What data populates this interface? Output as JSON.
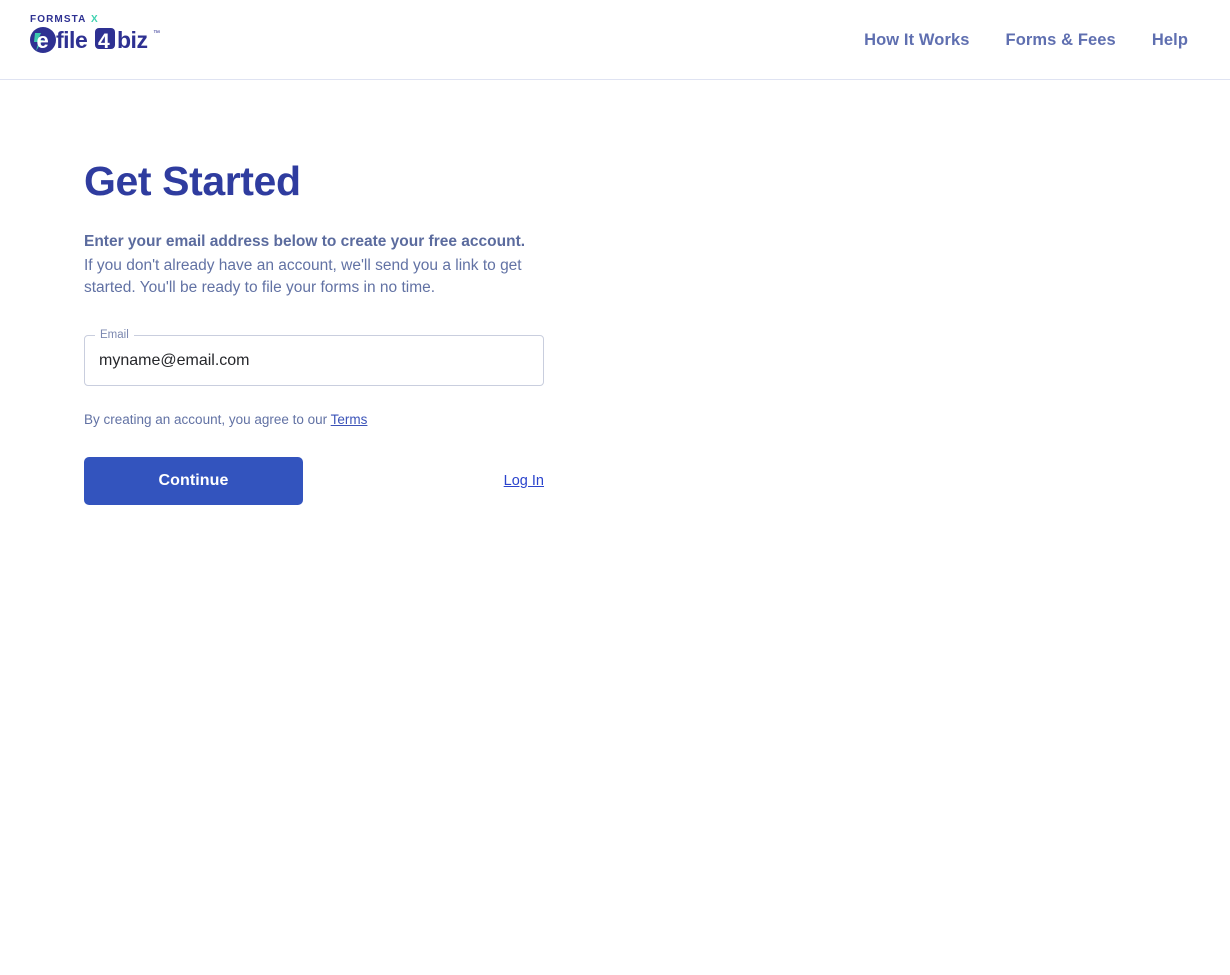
{
  "header": {
    "logo": {
      "brand_top": "FORMSTAX",
      "brand_main": "efile4biz",
      "trademark": "™",
      "navy": "#2e3192",
      "teal": "#3fd2b0"
    },
    "nav": [
      {
        "label": "How It Works",
        "name": "nav-how-it-works"
      },
      {
        "label": "Forms & Fees",
        "name": "nav-forms-and-fees"
      },
      {
        "label": "Help",
        "name": "nav-help"
      }
    ]
  },
  "main": {
    "title": "Get Started",
    "intro_bold": "Enter your email address below to create your free account.",
    "intro_body": "If you don't already have an account, we'll send you a link to get started. You'll be ready to file your forms in no time.",
    "email_field": {
      "label": "Email",
      "value": "myname@email.com",
      "placeholder": "myname@email.com"
    },
    "terms_prefix": "By creating an account, you agree to our ",
    "terms_link": "Terms",
    "continue_label": "Continue",
    "login_label": "Log In"
  },
  "colors": {
    "accent_button": "#3354be",
    "heading": "#2f3c9f",
    "nav_text": "#5f6fb0",
    "body_text": "#6272a4",
    "link": "#2b44cd",
    "border": "#dfe3f2"
  }
}
